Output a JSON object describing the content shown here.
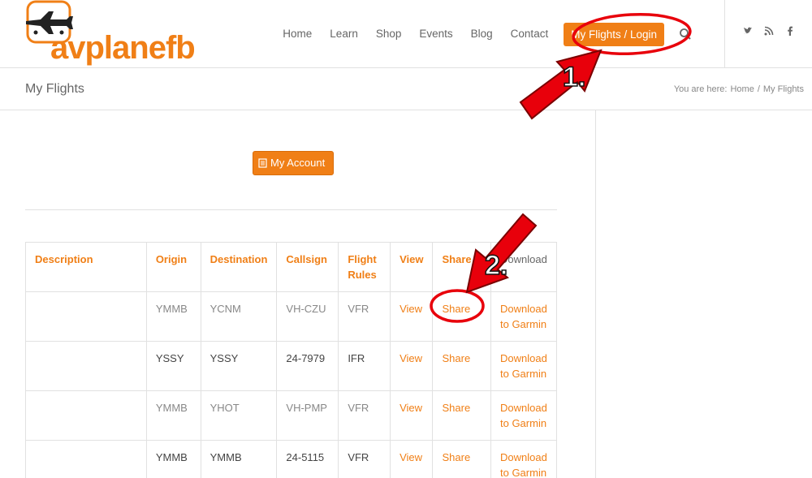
{
  "brand": {
    "name": "avplanefb",
    "accent": "#f07f16"
  },
  "nav": {
    "items": [
      "Home",
      "Learn",
      "Shop",
      "Events",
      "Blog",
      "Contact"
    ],
    "cta": "My Flights / Login"
  },
  "social": {
    "icons": [
      "twitter-icon",
      "rss-icon",
      "facebook-icon"
    ],
    "glyphs": [
      "𝕥",
      "⚞",
      "f"
    ]
  },
  "page": {
    "title": "My Flights"
  },
  "breadcrumb": {
    "prefix": "You are here:",
    "home": "Home",
    "sep": "/",
    "current": "My Flights"
  },
  "account_button": "My Account",
  "table": {
    "headers": [
      "Description",
      "Origin",
      "Destination",
      "Callsign",
      "Flight Rules",
      "View",
      "Share",
      "Download"
    ],
    "rows": [
      {
        "description": "",
        "origin": "YMMB",
        "destination": "YCNM",
        "callsign": "VH-CZU",
        "rules": "VFR",
        "view": "View",
        "share": "Share",
        "download": "Download to Garmin"
      },
      {
        "description": "",
        "origin": "YSSY",
        "destination": "YSSY",
        "callsign": "24-7979",
        "rules": "IFR",
        "view": "View",
        "share": "Share",
        "download": "Download to Garmin"
      },
      {
        "description": "",
        "origin": "YMMB",
        "destination": "YHOT",
        "callsign": "VH-PMP",
        "rules": "VFR",
        "view": "View",
        "share": "Share",
        "download": "Download to Garmin"
      },
      {
        "description": "",
        "origin": "YMMB",
        "destination": "YMMB",
        "callsign": "24-5115",
        "rules": "VFR",
        "view": "View",
        "share": "Share",
        "download": "Download to Garmin"
      }
    ]
  },
  "annotations": {
    "step1": "1.",
    "step2": "2.",
    "color": "#e8000b"
  }
}
